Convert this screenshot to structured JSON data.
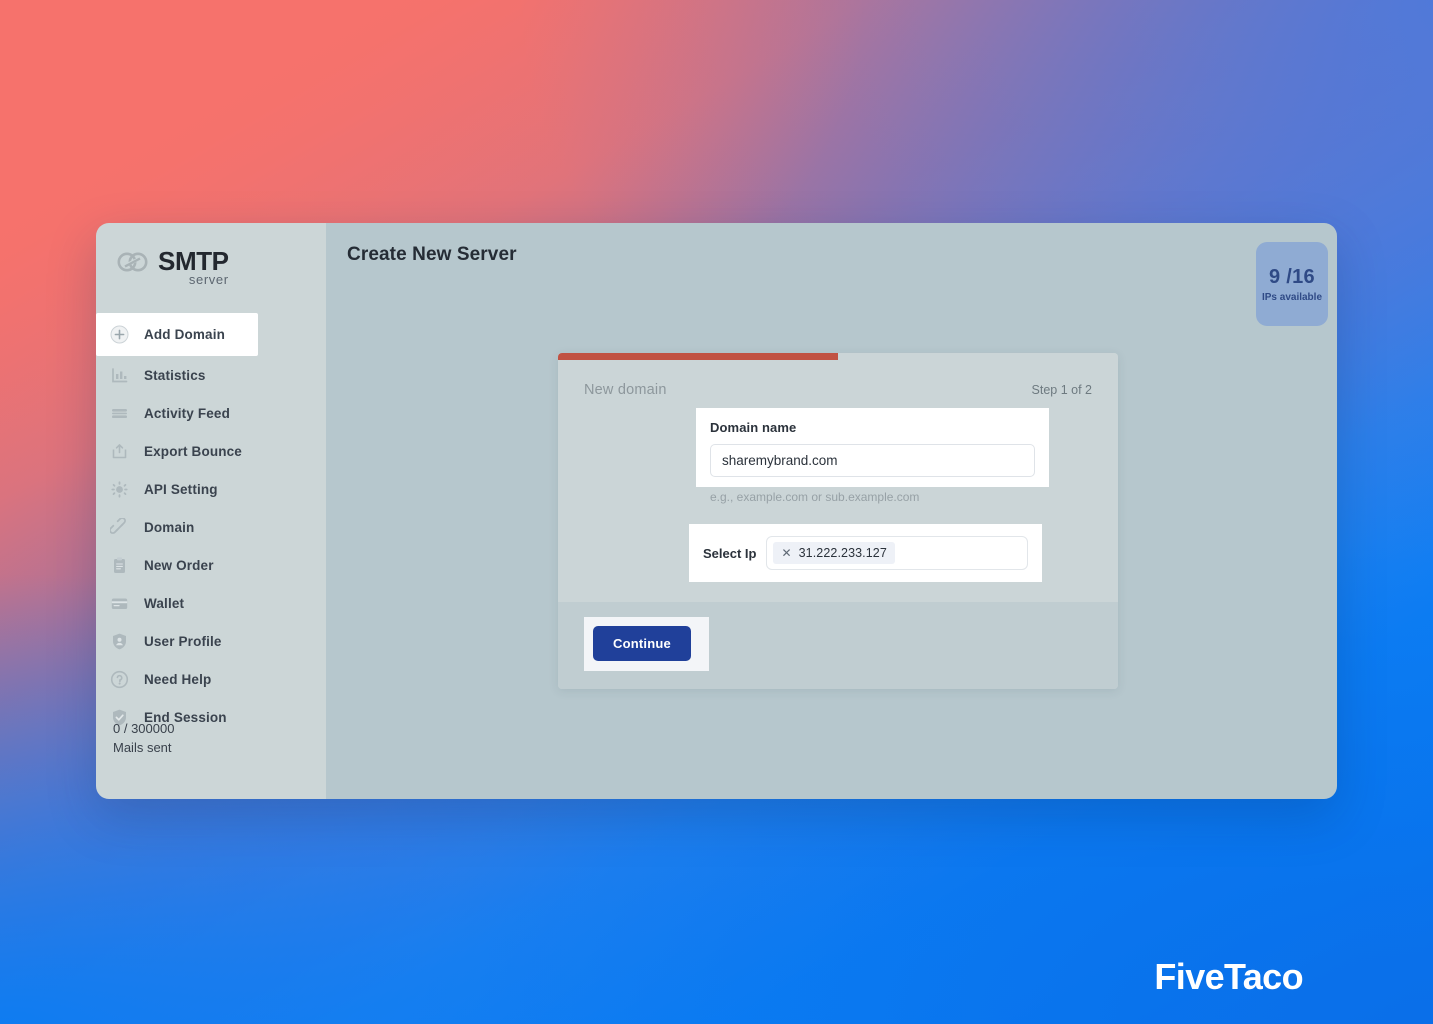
{
  "brand": {
    "logo_title": "SMTP",
    "logo_sub": "server",
    "logo_icon": "linked-circles-icon"
  },
  "sidebar": {
    "items": [
      {
        "label": "Add Domain",
        "icon": "plus-circle-icon",
        "active": true
      },
      {
        "label": "Statistics",
        "icon": "bar-chart-icon",
        "active": false
      },
      {
        "label": "Activity Feed",
        "icon": "stacked-lines-icon",
        "active": false
      },
      {
        "label": "Export Bounce",
        "icon": "upload-box-icon",
        "active": false
      },
      {
        "label": "API Setting",
        "icon": "gear-icon",
        "active": false
      },
      {
        "label": "Domain",
        "icon": "link-chain-icon",
        "active": false
      },
      {
        "label": "New Order",
        "icon": "clipboard-icon",
        "active": false
      },
      {
        "label": "Wallet",
        "icon": "card-icon",
        "active": false
      },
      {
        "label": "User Profile",
        "icon": "shield-user-icon",
        "active": false
      },
      {
        "label": "Need Help",
        "icon": "question-circle-icon",
        "active": false
      },
      {
        "label": "End Session",
        "icon": "shield-check-icon",
        "active": false
      }
    ],
    "mails_sent_count": "0 / 300000",
    "mails_sent_label": "Mails sent"
  },
  "header": {
    "title": "Create New Server"
  },
  "ip_badge": {
    "count": "9 /16",
    "label": "IPs available",
    "bg_color": "#8fabd3",
    "text_color": "#2f4a86"
  },
  "form_card": {
    "progress_percent": 50,
    "progress_color": "#c15243",
    "subtitle": "New domain",
    "step": "Step 1 of 2",
    "domain_field": {
      "label": "Domain name",
      "value": "sharemybrand.com",
      "placeholder": "example.com",
      "hint": "e.g., example.com or sub.example.com"
    },
    "ip_field": {
      "label": "Select Ip",
      "chips": [
        {
          "value": "31.222.233.127",
          "remove_icon": "close-icon"
        }
      ]
    },
    "continue_label": "Continue",
    "continue_color": "#20409a"
  },
  "watermark": {
    "text": "FiveTaco"
  }
}
